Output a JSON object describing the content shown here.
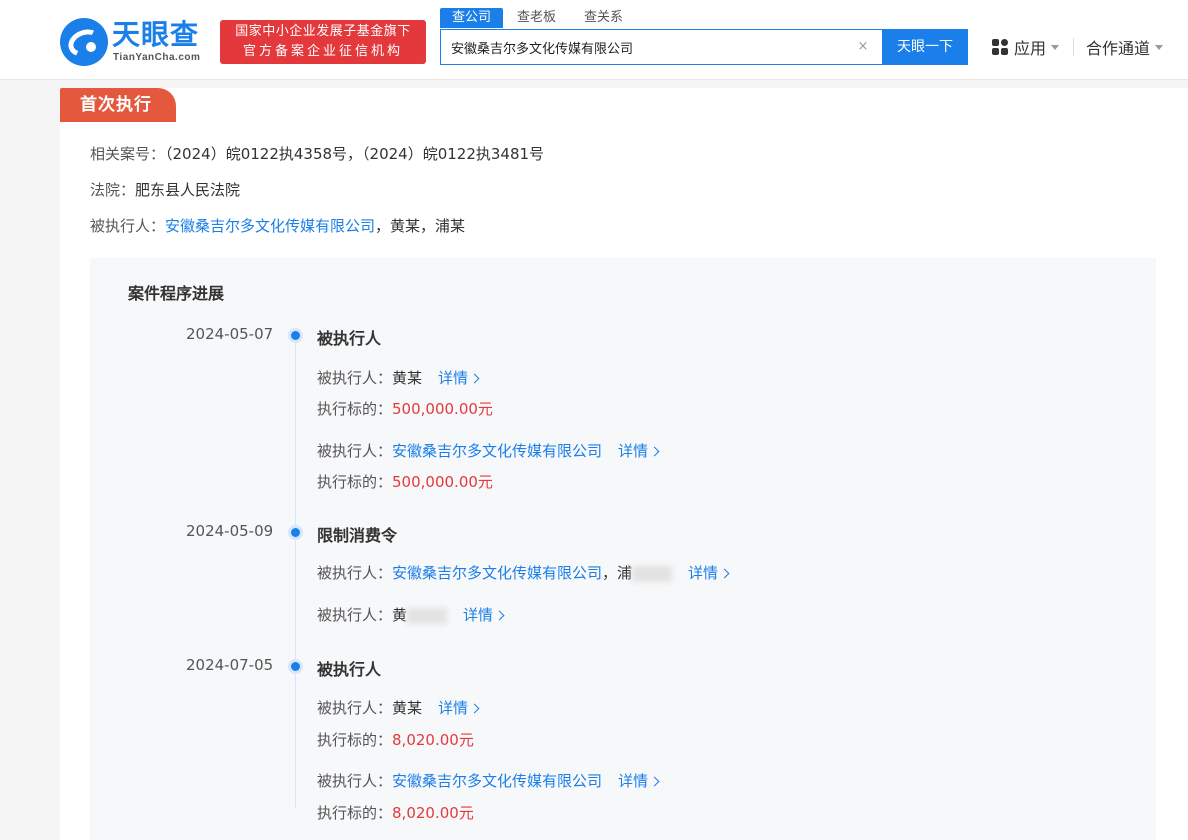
{
  "header": {
    "logo_title": "天眼查",
    "logo_sub": "TianYanCha.com",
    "banner_line1": "国家中小企业发展子基金旗下",
    "banner_line2": "官方备案企业征信机构",
    "search_tabs": [
      "查公司",
      "查老板",
      "查关系"
    ],
    "search_value": "安徽桑吉尔多文化传媒有限公司",
    "clear_symbol": "×",
    "search_button": "天眼一下",
    "apps_label": "应用",
    "coop_label": "合作通道"
  },
  "section": {
    "tag": "首次执行",
    "case_label": "相关案号：",
    "case_value": "（2024）皖0122执4358号，（2024）皖0122执3481号",
    "court_label": "法院：",
    "court_value": "肥东县人民法院",
    "executed_label": "被执行人：",
    "executed_company": "安徽桑吉尔多文化传媒有限公司",
    "executed_others": "，黄某，浦某"
  },
  "progress": {
    "title": "案件程序进展",
    "detail_label": "详情",
    "executed_label": "被执行人：",
    "amount_label": "执行标的：",
    "entries": [
      {
        "date": "2024-05-07",
        "type": "被执行人",
        "p1_name": "黄某",
        "p1_amount": "500,000.00元",
        "p2_company": "安徽桑吉尔多文化传媒有限公司",
        "p2_amount": "500,000.00元"
      },
      {
        "date": "2024-05-09",
        "type": "限制消费令",
        "l1_company": "安徽桑吉尔多文化传媒有限公司",
        "l1_tail": "，浦",
        "l2_name": "黄"
      },
      {
        "date": "2024-07-05",
        "type": "被执行人",
        "p1_name": "黄某",
        "p1_amount": "8,020.00元",
        "p2_company": "安徽桑吉尔多文化传媒有限公司",
        "p2_amount": "8,020.00元"
      }
    ]
  },
  "colors": {
    "brand_blue": "#1a7fe8",
    "tag_orange": "#e4593d",
    "amount_red": "#e4393c"
  }
}
